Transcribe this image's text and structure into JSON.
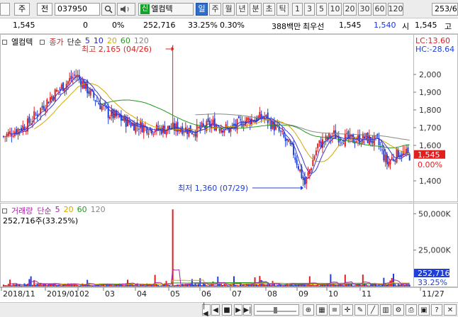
{
  "toolbar": {
    "market_code": "주",
    "prev_label": "전",
    "stock_code": "037950",
    "search_icon": "search-icon",
    "sound_icon": "speaker-icon",
    "new_badge": "신",
    "stock_name": "엘컴텍",
    "periods": [
      "일",
      "주",
      "월",
      "년",
      "분",
      "초",
      "틱"
    ],
    "active_period": "일",
    "intervals": [
      "1",
      "3",
      "5",
      "10",
      "20",
      "30",
      "60",
      "120"
    ],
    "count_value": "253/6"
  },
  "info": {
    "price": "1,545",
    "change": "0",
    "change_pct": "0%",
    "volume": "252,716",
    "turnover": "33.25%",
    "ratio": "0.30%",
    "amount_label": "388백만",
    "best_label": "최우선",
    "best_ask": "1,545",
    "best_bid": "1,540",
    "open_label": "시",
    "open_value": "1,545",
    "high_label": "고"
  },
  "price_panel": {
    "name": "엘컴텍",
    "legend": [
      {
        "text": "종가",
        "color": "#cc2222"
      },
      {
        "text": "단순",
        "color": "#222222"
      },
      {
        "text": "5",
        "color": "#2222cc"
      },
      {
        "text": "10",
        "color": "#2222cc"
      },
      {
        "text": "20",
        "color": "#d4a800"
      },
      {
        "text": "60",
        "color": "#229922"
      },
      {
        "text": "120",
        "color": "#888888"
      }
    ],
    "high_annotation": "최고 2,165 (04/26)",
    "low_annotation": "최저 1,360 (07/29)",
    "lc_label": "LC:13.60",
    "hc_label": "HC:-28.64",
    "y_ticks": [
      "2,000",
      "1,900",
      "1,800",
      "1,700",
      "1,600",
      "1,400"
    ],
    "current_price_tag": "1,545",
    "current_pct_tag": "0.00%"
  },
  "volume_panel": {
    "title": "거래량",
    "legend": [
      {
        "text": "단순",
        "color": "#aa22aa"
      },
      {
        "text": "5",
        "color": "#aa22aa"
      },
      {
        "text": "20",
        "color": "#d4a800"
      },
      {
        "text": "60",
        "color": "#229922"
      },
      {
        "text": "120",
        "color": "#888888"
      }
    ],
    "current_text": "252,716주(33.25%)",
    "y_ticks": [
      "50,000K",
      "25,000K"
    ],
    "volume_tag": "252,716",
    "pct_tag": "33.25%"
  },
  "x_axis": {
    "labels": [
      "2018/11",
      "2019/01",
      "02",
      "03",
      "04",
      "05",
      "06",
      "07",
      "08",
      "09",
      "10",
      "11",
      "11/27"
    ]
  },
  "colors": {
    "up": "#e01f1f",
    "down": "#1f3fd8",
    "ma5": "#3a3ad0",
    "ma10": "#3a3ad0",
    "ma20": "#d4a800",
    "ma60": "#229922",
    "ma120": "#888888",
    "tag_red": "#e01f1f",
    "tag_blue": "#1f3fd8"
  },
  "bottom_bar": {
    "nav_icons": [
      "first-icon",
      "prev-icon",
      "stop-icon",
      "play-icon",
      "last-icon"
    ]
  }
}
